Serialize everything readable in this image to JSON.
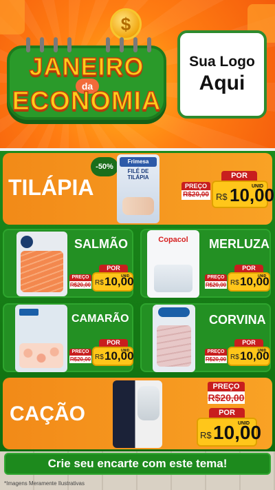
{
  "header": {
    "title_line1": "JANEIRO",
    "title_de": "da",
    "title_line2": "ECONOMIA",
    "logo_line1": "Sua Logo",
    "logo_line2": "Aqui"
  },
  "featured": {
    "name": "TILÁPIA",
    "discount": "-50%",
    "package_brand": "Frimesa",
    "package_title": "FILÉ DE TILÁPIA",
    "old_label": "PREÇO",
    "old_price": "R$20,00",
    "new_label": "POR",
    "currency": "R$",
    "price": "10,00",
    "unit": "UNID"
  },
  "products": [
    {
      "name": "SALMÃO",
      "old_label": "PREÇO",
      "old_price": "R$20,00",
      "new_label": "POR",
      "currency": "R$",
      "price": "10,00",
      "unit": "UNID"
    },
    {
      "name": "MERLUZA",
      "brand": "Copacol",
      "old_label": "PREÇO",
      "old_price": "R$20,00",
      "new_label": "POR",
      "currency": "R$",
      "price": "10,00",
      "unit": "UNID"
    },
    {
      "name": "CAMARÃO",
      "old_label": "PREÇO",
      "old_price": "R$20,00",
      "new_label": "POR",
      "currency": "R$",
      "price": "10,00",
      "unit": "UNID"
    },
    {
      "name": "CORVINA",
      "old_label": "PREÇO",
      "old_price": "R$20,00",
      "new_label": "POR",
      "currency": "R$",
      "price": "10,00",
      "unit": "UNID"
    }
  ],
  "cacao": {
    "name": "CAÇÃO",
    "old_label": "PREÇO",
    "old_price": "R$20,00",
    "new_label": "POR",
    "currency": "R$",
    "price": "10,00",
    "unit": "UNID"
  },
  "cta": "Crie seu encarte com este tema!",
  "footnote": "*Imagens Meramente Ilustrativas",
  "colors": {
    "orange": "#f28a18",
    "green": "#1c8a1c",
    "red": "#c81e1e",
    "yellow": "#ffc61a"
  }
}
